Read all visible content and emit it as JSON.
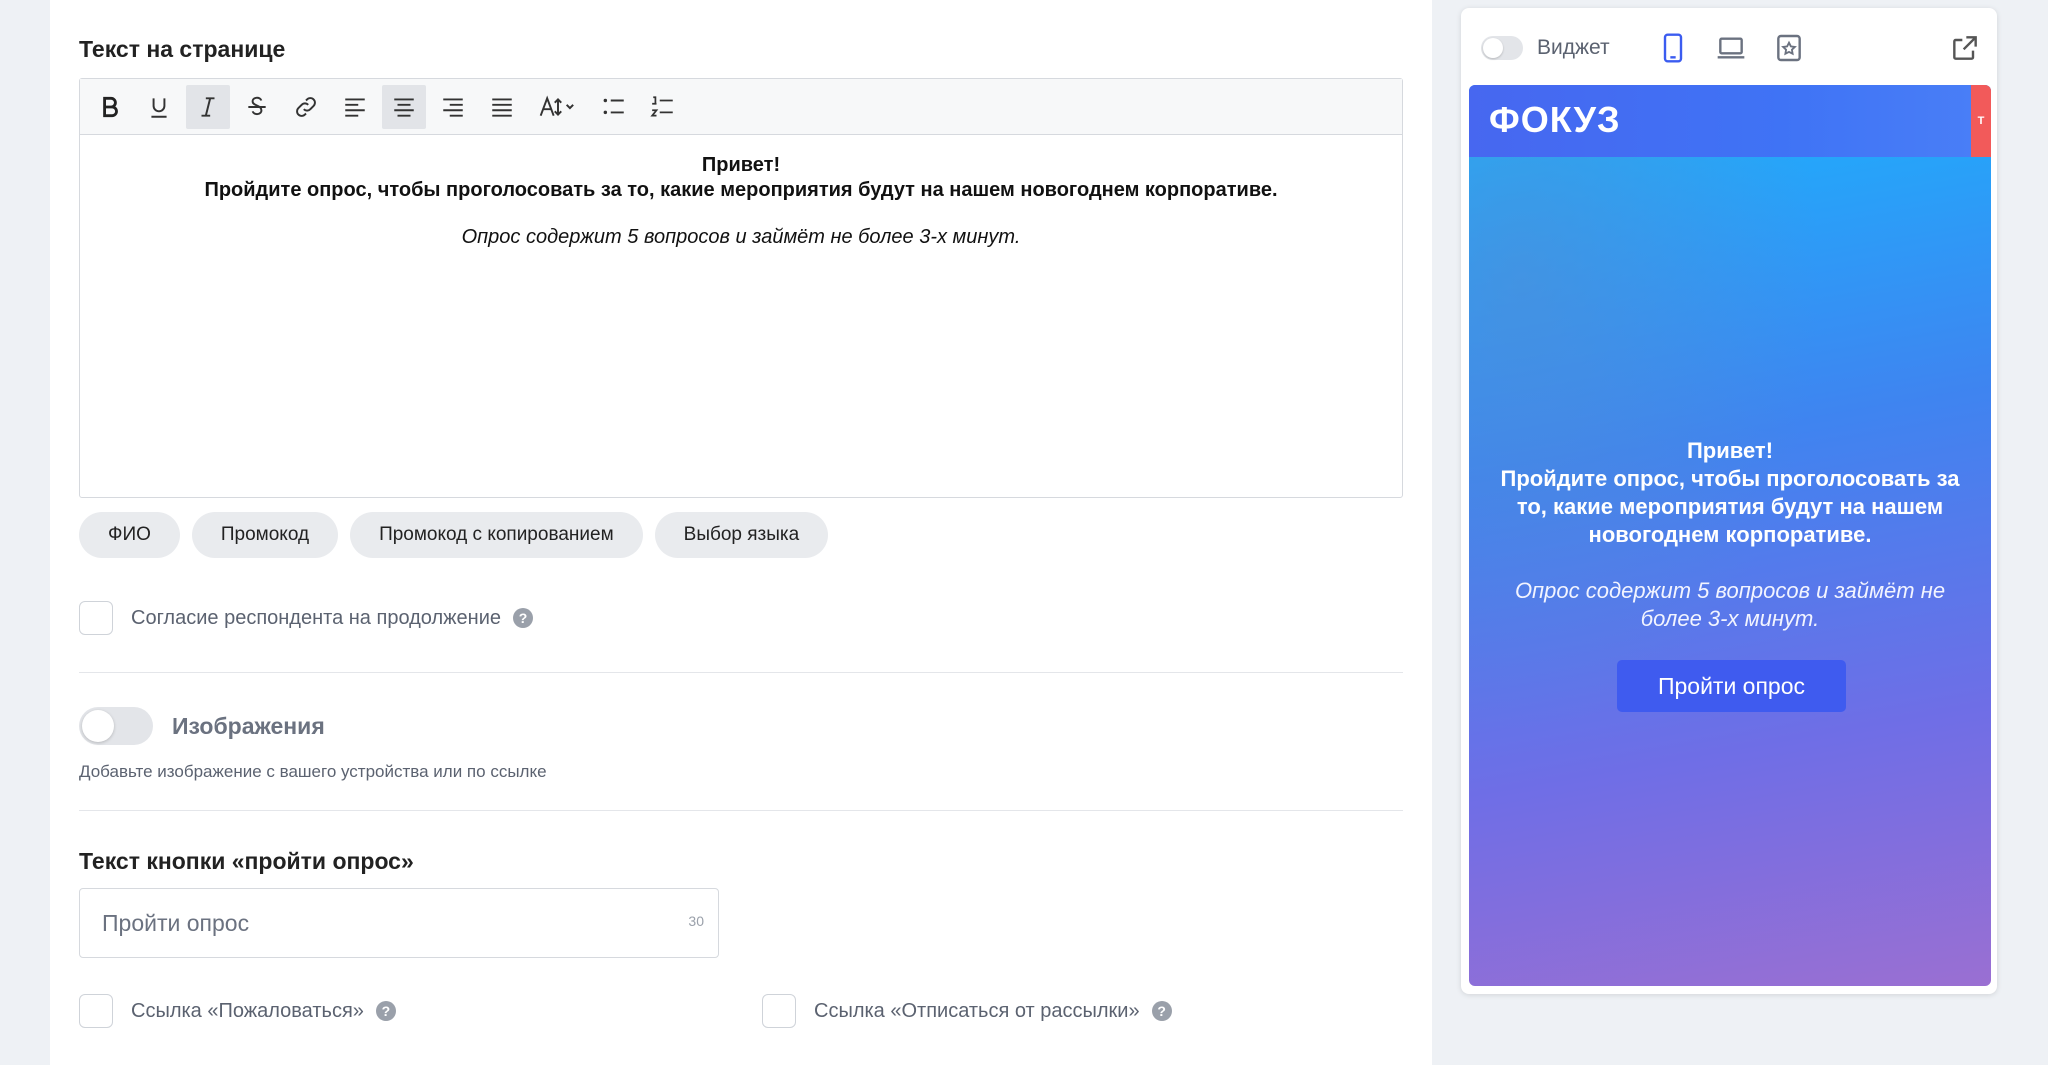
{
  "page": {
    "section_title": "Текст на странице",
    "editor": {
      "line1": "Привет!",
      "line2": "Пройдите опрос, чтобы проголосовать за то, какие мероприятия будут на нашем новогоднем корпоративе.",
      "line3": "Опрос содержит 5 вопросов и займёт не более 3-х минут."
    },
    "chips": [
      "ФИО",
      "Промокод",
      "Промокод с копированием",
      "Выбор языка"
    ],
    "consent_label": "Согласие респондента на продолжение",
    "images_toggle_label": "Изображения",
    "images_hint": "Добавьте изображение с вашего устройства или по ссылке",
    "button_text_title": "Текст кнопки «пройти опрос»",
    "button_text_value": "Пройти опрос",
    "button_text_counter": "30",
    "complain_link_label": "Ссылка «Пожаловаться»",
    "unsubscribe_link_label": "Ссылка «Отписаться от рассылки»",
    "help_glyph": "?"
  },
  "preview": {
    "widget_label": "Виджет",
    "logo": "ФОКУЗ",
    "tab_label": "T",
    "text_line1": "Привет!",
    "text_line2": "Пройдите опрос, чтобы проголосовать за то, какие мероприятия будут на нашем новогоднем корпоративе.",
    "text_line3": "Опрос содержит 5 вопросов и займёт не более 3-х минут.",
    "button_label": "Пройти опрос",
    "active_device": "mobile-icon"
  },
  "colors": {
    "accent": "#3f5bef",
    "active_device": "#3b5cf0",
    "gradient_top": "#18b6ff",
    "gradient_bottom": "#9a6fd2"
  }
}
